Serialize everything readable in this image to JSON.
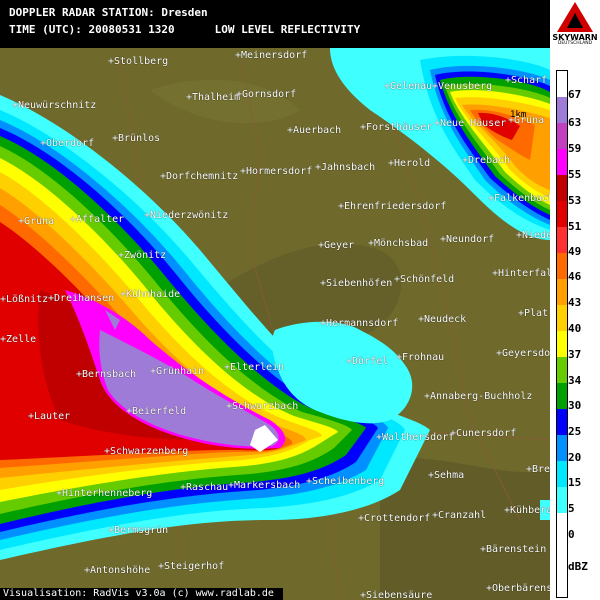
{
  "header": {
    "station": "DOPPLER RADAR STATION: Dresden",
    "time": "TIME (UTC): 20080531 1320",
    "product": "LOW LEVEL REFLECTIVITY"
  },
  "logo": {
    "brand": "SKYWARN",
    "sub": "DEUTSCHLAND"
  },
  "scale_label": "1km",
  "footer": "Visualisation: RadVis v3.0a (c) www.radlab.de",
  "legend": {
    "unit": "dBZ",
    "ticks": [
      "67",
      "63",
      "59",
      "55",
      "53",
      "51",
      "49",
      "46",
      "43",
      "40",
      "37",
      "34",
      "30",
      "25",
      "20",
      "15",
      "5",
      "0"
    ],
    "colors": [
      "#ffffff",
      "#9e7bd6",
      "#c040c0",
      "#ff00ff",
      "#c00000",
      "#e00000",
      "#ff3030",
      "#ff6a00",
      "#ff9f00",
      "#ffd000",
      "#ffff00",
      "#66cc00",
      "#00a000",
      "#0000ff",
      "#0090ff",
      "#00e8ff",
      "#40ffff"
    ]
  },
  "places": [
    {
      "name": "+Meinersdorf"
    },
    {
      "name": "+Stollberg"
    },
    {
      "name": "+Gelenau"
    },
    {
      "name": "+Venusberg"
    },
    {
      "name": "+Scharf"
    },
    {
      "name": "+Neuwürschnitz"
    },
    {
      "name": "+Thalheim"
    },
    {
      "name": "+Gornsdorf"
    },
    {
      "name": "+Brünlos"
    },
    {
      "name": "+Auerbach"
    },
    {
      "name": "+Forsthäuser"
    },
    {
      "name": "+Neue Häuser"
    },
    {
      "name": "+Grüna"
    },
    {
      "name": "+Oberdorf"
    },
    {
      "name": "+Jahnsbach"
    },
    {
      "name": "+Herold"
    },
    {
      "name": "+Drebach"
    },
    {
      "name": "+Dorfchemnitz"
    },
    {
      "name": "+Hormersdorf"
    },
    {
      "name": "+Falkenbach"
    },
    {
      "name": "+Grüna"
    },
    {
      "name": "+Affalter"
    },
    {
      "name": "+Niederzwönitz"
    },
    {
      "name": "+Ehrenfriedersdorf"
    },
    {
      "name": "+Geyer"
    },
    {
      "name": "+Mönchsbad"
    },
    {
      "name": "+Neundorf"
    },
    {
      "name": "+Niede"
    },
    {
      "name": "+Zwönitz"
    },
    {
      "name": "+Hinterfal"
    },
    {
      "name": "+Siebenhöfen"
    },
    {
      "name": "+Schönfeld"
    },
    {
      "name": "+Lößnitz"
    },
    {
      "name": "+Dreihansen"
    },
    {
      "name": "+Kühnhaide"
    },
    {
      "name": "+Plat"
    },
    {
      "name": "+Hermannsdorf"
    },
    {
      "name": "+Neudeck"
    },
    {
      "name": "+Zelle"
    },
    {
      "name": "+Dörfel"
    },
    {
      "name": "+Frohnau"
    },
    {
      "name": "+Geyersdo"
    },
    {
      "name": "+Elterlein"
    },
    {
      "name": "+Bernsbach"
    },
    {
      "name": "+Grünhain"
    },
    {
      "name": "+Annaberg-Buchholz"
    },
    {
      "name": "+Schwarzbach"
    },
    {
      "name": "+Beierfeld"
    },
    {
      "name": "+Lauter"
    },
    {
      "name": "+Walthersdorf"
    },
    {
      "name": "+Cunersdorf"
    },
    {
      "name": "+Schwarzenberg"
    },
    {
      "name": "+Bre"
    },
    {
      "name": "+Sehma"
    },
    {
      "name": "+Scheibenberg"
    },
    {
      "name": "+Raschau"
    },
    {
      "name": "+Markersbach"
    },
    {
      "name": "+Hinterhenneberg"
    },
    {
      "name": "+Crottendorf"
    },
    {
      "name": "+Cranzahl"
    },
    {
      "name": "+Kühbera"
    },
    {
      "name": "+Bermsgrün"
    },
    {
      "name": "+Bärenstein"
    },
    {
      "name": "+Antonshöhe"
    },
    {
      "name": "+Steigerhof"
    },
    {
      "name": "+Oberbärens"
    },
    {
      "name": "+Siebensäure"
    }
  ]
}
